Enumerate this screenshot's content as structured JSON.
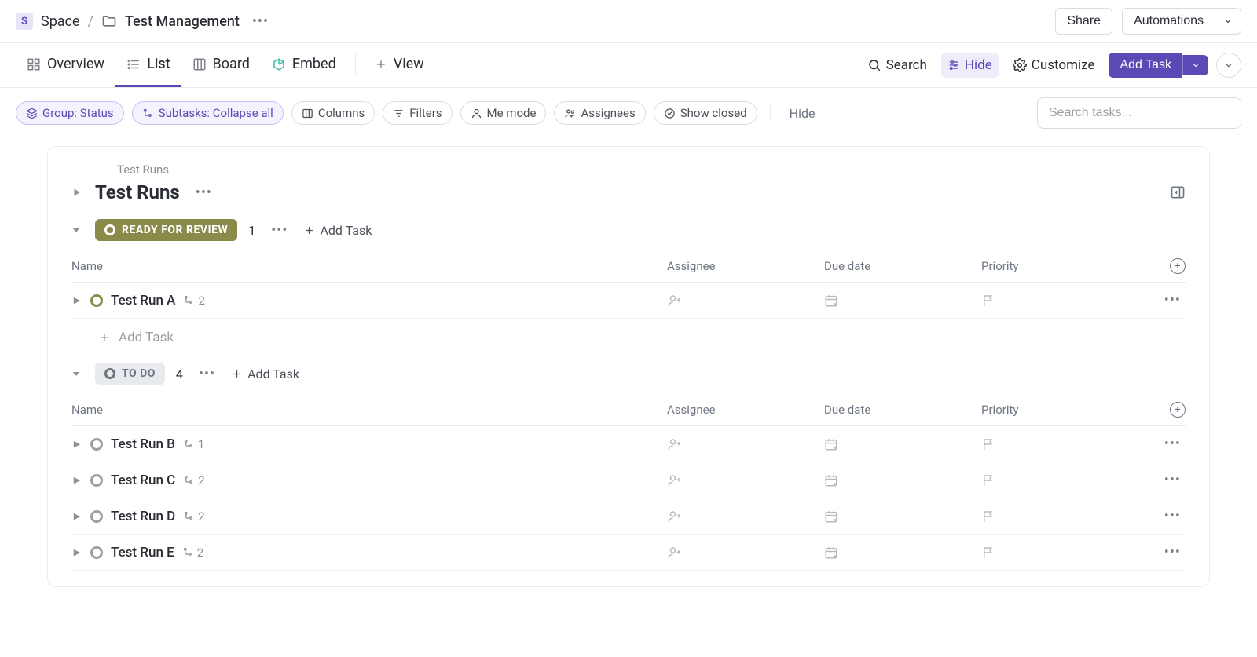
{
  "breadcrumb": {
    "space_badge": "S",
    "space_label": "Space",
    "folder_label": "Test Management"
  },
  "top_buttons": {
    "share": "Share",
    "automations": "Automations"
  },
  "views": {
    "overview": "Overview",
    "list": "List",
    "board": "Board",
    "embed": "Embed",
    "add_view": "View"
  },
  "view_actions": {
    "search": "Search",
    "hide": "Hide",
    "customize": "Customize",
    "add_task": "Add Task"
  },
  "filters": {
    "group": "Group: Status",
    "subtasks": "Subtasks: Collapse all",
    "columns": "Columns",
    "filters": "Filters",
    "me_mode": "Me mode",
    "assignees": "Assignees",
    "show_closed": "Show closed",
    "hide": "Hide"
  },
  "search": {
    "placeholder": "Search tasks..."
  },
  "list": {
    "crumb": "Test Runs",
    "title": "Test Runs",
    "columns": {
      "name": "Name",
      "assignee": "Assignee",
      "due": "Due date",
      "priority": "Priority"
    },
    "add_task": "Add Task",
    "groups": [
      {
        "status_label": "READY FOR REVIEW",
        "status_class": "status-ready",
        "count": "1",
        "tasks": [
          {
            "name": "Test Run A",
            "subtasks": "2",
            "dot_class": ""
          }
        ]
      },
      {
        "status_label": "TO DO",
        "status_class": "status-todo",
        "count": "4",
        "tasks": [
          {
            "name": "Test Run B",
            "subtasks": "1",
            "dot_class": "todo"
          },
          {
            "name": "Test Run C",
            "subtasks": "2",
            "dot_class": "todo"
          },
          {
            "name": "Test Run D",
            "subtasks": "2",
            "dot_class": "todo"
          },
          {
            "name": "Test Run E",
            "subtasks": "2",
            "dot_class": "todo"
          }
        ]
      }
    ]
  }
}
